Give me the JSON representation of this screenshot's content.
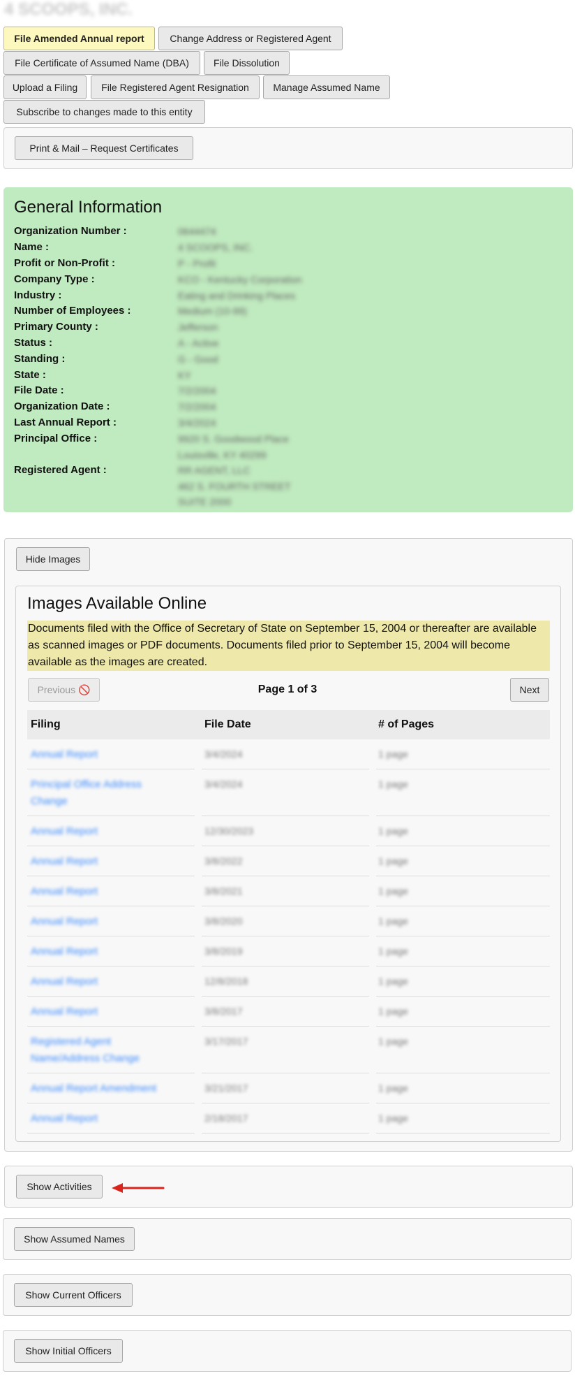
{
  "entity_name": "4 SCOOPS, INC.",
  "actions": [
    {
      "label": "File Amended Annual report"
    },
    {
      "label": "Change Address or Registered Agent"
    },
    {
      "label": "File Certificate of Assumed Name (DBA)"
    },
    {
      "label": "File Dissolution"
    },
    {
      "label": "Upload a Filing"
    },
    {
      "label": "File Registered Agent Resignation"
    },
    {
      "label": "Manage Assumed Name"
    },
    {
      "label": "Subscribe to changes made to this entity"
    }
  ],
  "print_mail_label": "Print & Mail – Request Certificates",
  "general": {
    "heading": "General Information",
    "rows": [
      {
        "label": "Organization Number :",
        "value": "0644474"
      },
      {
        "label": "Name :",
        "value": "4 SCOOPS, INC."
      },
      {
        "label": "Profit or Non-Profit :",
        "value": "P - Profit"
      },
      {
        "label": "Company Type :",
        "value": "KCO - Kentucky Corporation"
      },
      {
        "label": "Industry :",
        "value": "Eating and Drinking Places"
      },
      {
        "label": "Number of Employees :",
        "value": "Medium (10-99)"
      },
      {
        "label": "Primary County :",
        "value": "Jefferson"
      },
      {
        "label": "Status :",
        "value": "A - Active"
      },
      {
        "label": "Standing :",
        "value": "G - Good"
      },
      {
        "label": "State :",
        "value": "KY"
      },
      {
        "label": "File Date :",
        "value": "7/2/2004"
      },
      {
        "label": "Organization Date :",
        "value": "7/2/2004"
      },
      {
        "label": "Last Annual Report :",
        "value": "3/4/2024"
      },
      {
        "label": "Principal Office :",
        "value": "9920 S. Goodwood Place",
        "value2": "Louisville, KY 40299"
      },
      {
        "label": "Registered Agent :",
        "value": "RR AGENT, LLC",
        "value2": "462 S. FOURTH STREET",
        "value3": "SUITE 2000"
      }
    ]
  },
  "hide_images_label": "Hide Images",
  "images": {
    "heading": "Images Available Online",
    "notice": "Documents filed with the Office of Secretary of State on September 15, 2004 or thereafter are available as scanned images or PDF documents. Documents filed prior to September 15, 2004 will become available as the images are created.",
    "prev_label": "Previous 🚫",
    "page_label": "Page 1 of 3",
    "next_label": "Next",
    "columns": [
      "Filing",
      "File Date",
      "# of Pages"
    ],
    "rows": [
      {
        "filing": "Annual Report",
        "date": "3/4/2024",
        "pages": "1 page"
      },
      {
        "filing": "Principal Office Address Change",
        "date": "3/4/2024",
        "pages": "1 page"
      },
      {
        "filing": "Annual Report",
        "date": "12/30/2023",
        "pages": "1 page"
      },
      {
        "filing": "Annual Report",
        "date": "3/8/2022",
        "pages": "1 page"
      },
      {
        "filing": "Annual Report",
        "date": "3/8/2021",
        "pages": "1 page"
      },
      {
        "filing": "Annual Report",
        "date": "3/8/2020",
        "pages": "1 page"
      },
      {
        "filing": "Annual Report",
        "date": "3/8/2019",
        "pages": "1 page"
      },
      {
        "filing": "Annual Report",
        "date": "12/8/2018",
        "pages": "1 page"
      },
      {
        "filing": "Annual Report",
        "date": "3/8/2017",
        "pages": "1 page"
      },
      {
        "filing": "Registered Agent Name/Address Change",
        "date": "3/17/2017",
        "pages": "1 page"
      },
      {
        "filing": "Annual Report Amendment",
        "date": "3/21/2017",
        "pages": "1 page"
      },
      {
        "filing": "Annual Report",
        "date": "2/18/2017",
        "pages": "1 page"
      }
    ]
  },
  "show_activities_label": "Show Activities",
  "show_assumed_names_label": "Show Assumed Names",
  "show_current_officers_label": "Show Current Officers",
  "show_initial_officers_label": "Show Initial Officers",
  "colors": {
    "general_bg": "#c0eabf",
    "highlight_button": "#fdf8bd",
    "notice_bg": "#eee9aa",
    "link": "#3d8bfd",
    "arrow": "#d9251c"
  }
}
